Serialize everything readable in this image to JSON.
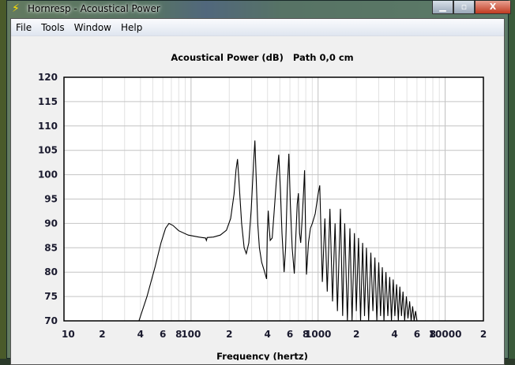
{
  "window": {
    "title": "Hornresp - Acoustical Power",
    "icon": "lightning-icon",
    "buttons": [
      "minimize",
      "maximize",
      "close"
    ]
  },
  "menu": [
    "File",
    "Tools",
    "Window",
    "Help"
  ],
  "chart_data": {
    "type": "line",
    "title": "Acoustical Power (dB)   Path 0,0 cm",
    "xlabel": "Frequency (hertz)",
    "ylabel": "",
    "xscale": "log",
    "xlim": [
      10,
      20000
    ],
    "ylim": [
      70,
      120
    ],
    "yticks": [
      120,
      115,
      110,
      105,
      100,
      95,
      90,
      85,
      80,
      75,
      70
    ],
    "xticks": [
      {
        "v": 10,
        "l": "10"
      },
      {
        "v": 20,
        "l": "2"
      },
      {
        "v": 40,
        "l": "4"
      },
      {
        "v": 60,
        "l": "6"
      },
      {
        "v": 80,
        "l": "8"
      },
      {
        "v": 100,
        "l": "100"
      },
      {
        "v": 200,
        "l": "2"
      },
      {
        "v": 400,
        "l": "4"
      },
      {
        "v": 600,
        "l": "6"
      },
      {
        "v": 800,
        "l": "8"
      },
      {
        "v": 1000,
        "l": "1000"
      },
      {
        "v": 2000,
        "l": "2"
      },
      {
        "v": 4000,
        "l": "4"
      },
      {
        "v": 6000,
        "l": "6"
      },
      {
        "v": 8000,
        "l": "8"
      },
      {
        "v": 10000,
        "l": "10000"
      },
      {
        "v": 20000,
        "l": "2"
      }
    ],
    "grid": true,
    "series": [
      {
        "name": "Acoustical Power",
        "color": "#000000",
        "points": [
          [
            38.9,
            70
          ],
          [
            45,
            75
          ],
          [
            52,
            81
          ],
          [
            58,
            86
          ],
          [
            63,
            89
          ],
          [
            67,
            90
          ],
          [
            72,
            89.6
          ],
          [
            80,
            88.5
          ],
          [
            95,
            87.6
          ],
          [
            115,
            87.2
          ],
          [
            130,
            87.0
          ],
          [
            132,
            86.5
          ],
          [
            134,
            87.1
          ],
          [
            150,
            87.2
          ],
          [
            170,
            87.6
          ],
          [
            190,
            88.6
          ],
          [
            205,
            91
          ],
          [
            218,
            96
          ],
          [
            226,
            101
          ],
          [
            232,
            103.2
          ],
          [
            238,
            99
          ],
          [
            250,
            90
          ],
          [
            262,
            85
          ],
          [
            272,
            83.8
          ],
          [
            285,
            86
          ],
          [
            298,
            93
          ],
          [
            310,
            102
          ],
          [
            318,
            107
          ],
          [
            325,
            100
          ],
          [
            335,
            90
          ],
          [
            345,
            85
          ],
          [
            360,
            82
          ],
          [
            380,
            80
          ],
          [
            393,
            78.6
          ],
          [
            398,
            88
          ],
          [
            405,
            92.6
          ],
          [
            412,
            89
          ],
          [
            420,
            86.5
          ],
          [
            435,
            87
          ],
          [
            450,
            92
          ],
          [
            470,
            99
          ],
          [
            490,
            104.1
          ],
          [
            505,
            97
          ],
          [
            520,
            88
          ],
          [
            540,
            80
          ],
          [
            555,
            85
          ],
          [
            572,
            97
          ],
          [
            589,
            104.3
          ],
          [
            605,
            94
          ],
          [
            625,
            85
          ],
          [
            650,
            79.7
          ],
          [
            665,
            86
          ],
          [
            685,
            94
          ],
          [
            700,
            96.2
          ],
          [
            715,
            88
          ],
          [
            730,
            86
          ],
          [
            745,
            90
          ],
          [
            770,
            97
          ],
          [
            783,
            100.9
          ],
          [
            795,
            90
          ],
          [
            810,
            79.5
          ],
          [
            840,
            86
          ],
          [
            870,
            89
          ],
          [
            900,
            90
          ],
          [
            950,
            92
          ],
          [
            1000,
            96
          ],
          [
            1030,
            97.8
          ],
          [
            1080,
            78
          ],
          [
            1130,
            91
          ],
          [
            1180,
            76
          ],
          [
            1240,
            93
          ],
          [
            1300,
            74
          ],
          [
            1360,
            90
          ],
          [
            1420,
            72
          ],
          [
            1500,
            93
          ],
          [
            1560,
            71
          ],
          [
            1620,
            90
          ],
          [
            1700,
            70
          ],
          [
            1780,
            89
          ],
          [
            1850,
            70
          ],
          [
            1930,
            88
          ],
          [
            2000,
            72
          ],
          [
            2080,
            87
          ],
          [
            2160,
            70
          ],
          [
            2240,
            86
          ],
          [
            2320,
            71
          ],
          [
            2400,
            85
          ],
          [
            2500,
            70
          ],
          [
            2600,
            84
          ],
          [
            2700,
            72
          ],
          [
            2800,
            83
          ],
          [
            2900,
            70
          ],
          [
            3000,
            82
          ],
          [
            3100,
            71
          ],
          [
            3200,
            81
          ],
          [
            3300,
            70
          ],
          [
            3420,
            80
          ],
          [
            3540,
            71
          ],
          [
            3660,
            79
          ],
          [
            3780,
            70
          ],
          [
            3900,
            78.5
          ],
          [
            4020,
            71
          ],
          [
            4150,
            77.5
          ],
          [
            4280,
            70
          ],
          [
            4400,
            77
          ],
          [
            4530,
            71
          ],
          [
            4660,
            76
          ],
          [
            4800,
            70
          ],
          [
            4950,
            75
          ],
          [
            5100,
            70.5
          ],
          [
            5250,
            74
          ],
          [
            5400,
            70
          ],
          [
            5550,
            73
          ],
          [
            5700,
            70
          ],
          [
            5850,
            72
          ],
          [
            6000,
            70
          ]
        ]
      }
    ]
  }
}
